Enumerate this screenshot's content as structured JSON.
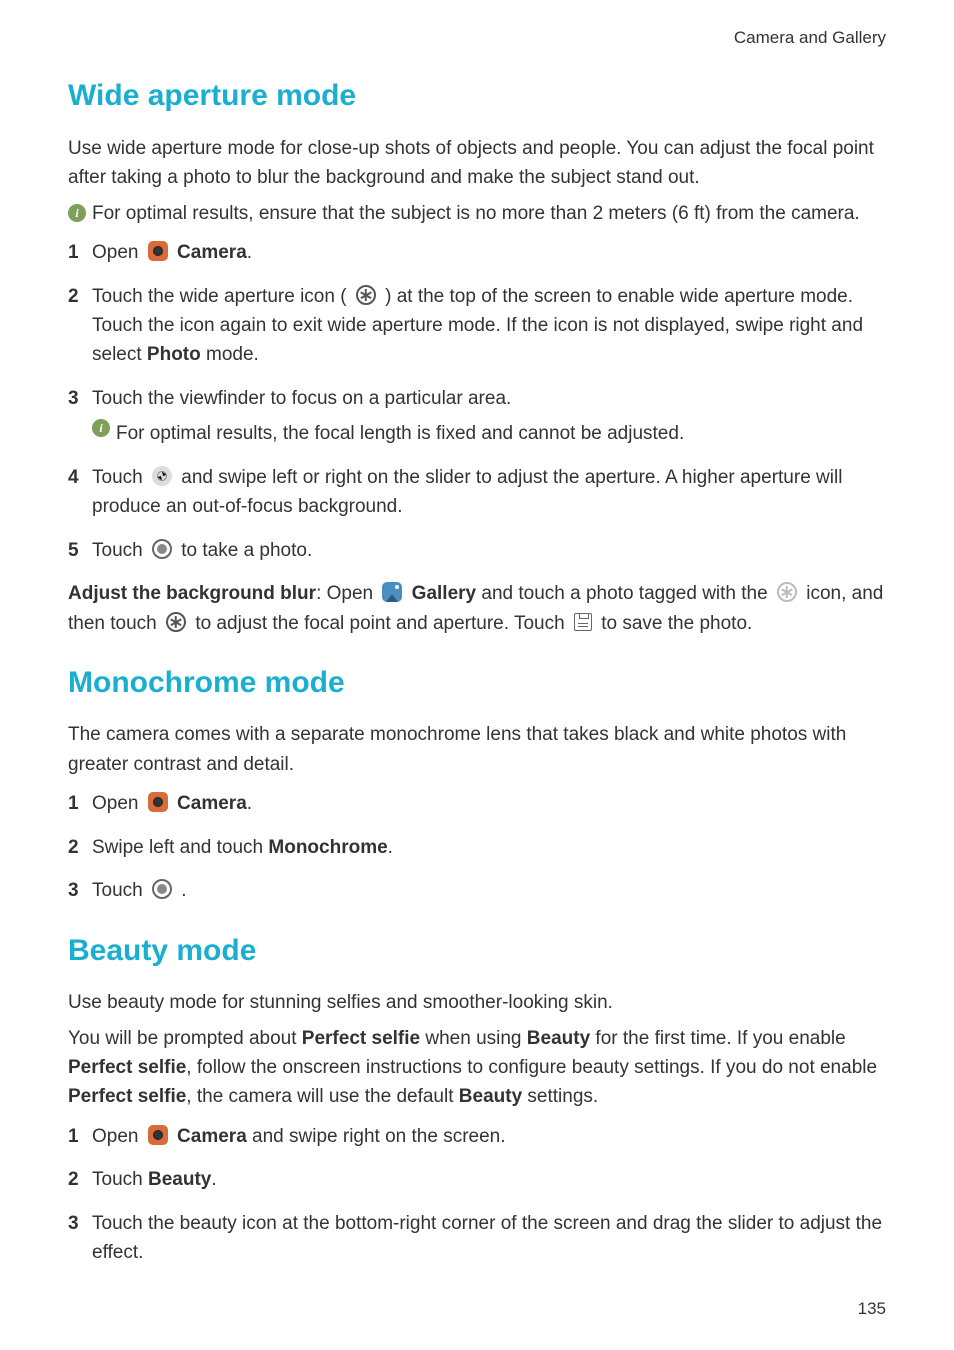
{
  "header": {
    "section": "Camera and Gallery"
  },
  "wide": {
    "title": "Wide aperture mode",
    "intro": "Use wide aperture mode for close-up shots of objects and people. You can adjust the focal point after taking a photo to blur the background and make the subject stand out.",
    "info1": "For optimal results, ensure that the subject is no more than 2 meters (6 ft) from the camera.",
    "s1_a": "Open ",
    "s1_b": "Camera",
    "s1_c": ".",
    "s2_a": "Touch the wide aperture icon ( ",
    "s2_b": " ) at the top of the screen to enable wide aperture mode. Touch the icon again to exit wide aperture mode. If the icon is not displayed, swipe right and select ",
    "s2_c": "Photo",
    "s2_d": " mode.",
    "s3": "Touch the viewfinder to focus on a particular area.",
    "s3_info": "For optimal results, the focal length is fixed and cannot be adjusted.",
    "s4_a": "Touch ",
    "s4_b": " and swipe left or right on the slider to adjust the aperture. A higher aperture will produce an out-of-focus background.",
    "s5_a": "Touch ",
    "s5_b": " to take a photo.",
    "adj_a": "Adjust the background blur",
    "adj_b": ": Open ",
    "adj_c": "Gallery",
    "adj_d": " and touch a photo tagged with the ",
    "adj_e": " icon, and then touch ",
    "adj_f": " to adjust the focal point and aperture. Touch ",
    "adj_g": " to save the photo."
  },
  "mono": {
    "title": "Monochrome mode",
    "intro": "The camera comes with a separate monochrome lens that takes black and white photos with greater contrast and detail.",
    "s1_a": "Open ",
    "s1_b": "Camera",
    "s1_c": ".",
    "s2_a": "Swipe left and touch ",
    "s2_b": "Monochrome",
    "s2_c": ".",
    "s3_a": "Touch ",
    "s3_b": " ."
  },
  "beauty": {
    "title": "Beauty mode",
    "intro": "Use beauty mode for stunning selfies and smoother-looking skin.",
    "p2_a": "You will be prompted about ",
    "p2_b": "Perfect selfie",
    "p2_c": " when using ",
    "p2_d": "Beauty",
    "p2_e": " for the first time. If you enable ",
    "p2_f": "Perfect selfie",
    "p2_g": ", follow the onscreen instructions to configure beauty settings. If you do not enable ",
    "p2_h": "Perfect selfie",
    "p2_i": ", the camera will use the default ",
    "p2_j": "Beauty",
    "p2_k": " settings.",
    "s1_a": "Open ",
    "s1_b": "Camera",
    "s1_c": " and swipe right on the screen.",
    "s2_a": "Touch ",
    "s2_b": "Beauty",
    "s2_c": ".",
    "s3": "Touch the beauty icon at the bottom-right corner of the screen and drag the slider to adjust the effect."
  },
  "footer": {
    "page": "135"
  }
}
